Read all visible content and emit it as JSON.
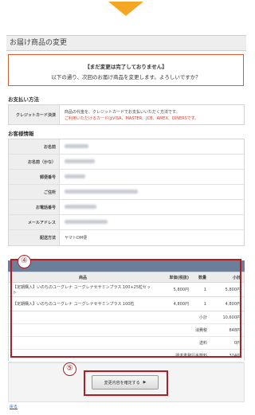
{
  "page": {
    "title": "お届け商品の変更",
    "notice_title": "【まだ変更は完了しておりません】",
    "notice_text": "以下の通り、次回のお届け商品を変更します。よろしいですか？"
  },
  "payment": {
    "section_title": "お支払い方法",
    "label": "クレジットカード決済",
    "text": "商品の代金を、クレジットカードでお支払いいただく方法です。",
    "cards": "ご利用いただけるカードはVISA、MASTER、JCB、AMEX、DINERSです。"
  },
  "customer": {
    "section_title": "お客様情報",
    "rows": [
      {
        "label": "お名前",
        "value": ""
      },
      {
        "label": "お名前（かな）",
        "value": ""
      },
      {
        "label": "郵便番号",
        "value": ""
      },
      {
        "label": "ご住所",
        "value": ""
      },
      {
        "label": "お電話番号",
        "value": ""
      },
      {
        "label": "メールアドレス",
        "value": ""
      },
      {
        "label": "配送方法",
        "value": "ヤマトDM便"
      }
    ]
  },
  "products": {
    "headers": {
      "name": "商品",
      "price": "単価(税抜)",
      "qty": "数量",
      "subtotal": "小計"
    },
    "items": [
      {
        "name": "【定期購入】いのちのユーグレナ ユーグレナセサミンプラス 100+25粒セット",
        "price": "5,800円",
        "qty": "1",
        "subtotal": "5,800円"
      },
      {
        "name": "【定期購入】いのちのユーグレナ ユーグレナセサミンプラス 100粒",
        "price": "4,800円",
        "qty": "1",
        "subtotal": "4,800円"
      }
    ],
    "summary": [
      {
        "label": "小計",
        "value": "10,600円"
      },
      {
        "label": "消費税",
        "value": "848円"
      },
      {
        "label": "送料",
        "value": "0円"
      },
      {
        "label": "請求書発行手数料",
        "value": "324円"
      }
    ]
  },
  "annotations": {
    "step4": "④",
    "step5": "⑤"
  },
  "actions": {
    "confirm_label": "変更内容を確定する",
    "confirm_arrow": "▶",
    "back_label": "戻る"
  }
}
